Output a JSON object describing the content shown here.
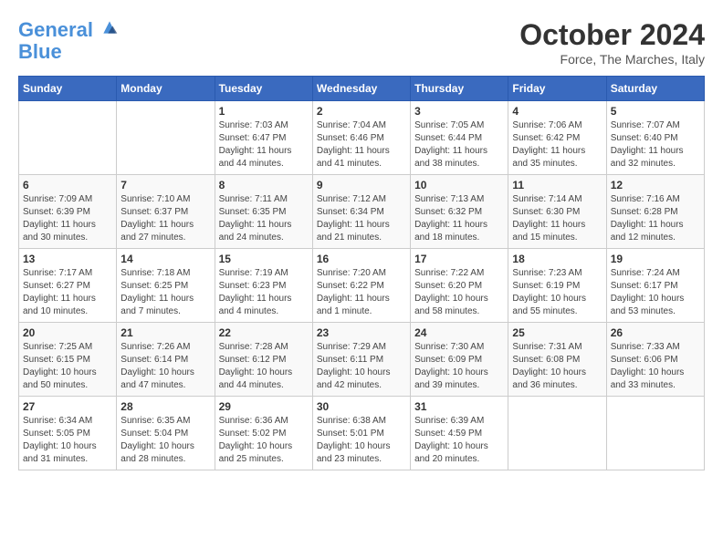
{
  "header": {
    "logo_line1": "General",
    "logo_line2": "Blue",
    "month": "October 2024",
    "location": "Force, The Marches, Italy"
  },
  "days_of_week": [
    "Sunday",
    "Monday",
    "Tuesday",
    "Wednesday",
    "Thursday",
    "Friday",
    "Saturday"
  ],
  "weeks": [
    [
      {
        "day": "",
        "info": ""
      },
      {
        "day": "",
        "info": ""
      },
      {
        "day": "1",
        "info": "Sunrise: 7:03 AM\nSunset: 6:47 PM\nDaylight: 11 hours and 44 minutes."
      },
      {
        "day": "2",
        "info": "Sunrise: 7:04 AM\nSunset: 6:46 PM\nDaylight: 11 hours and 41 minutes."
      },
      {
        "day": "3",
        "info": "Sunrise: 7:05 AM\nSunset: 6:44 PM\nDaylight: 11 hours and 38 minutes."
      },
      {
        "day": "4",
        "info": "Sunrise: 7:06 AM\nSunset: 6:42 PM\nDaylight: 11 hours and 35 minutes."
      },
      {
        "day": "5",
        "info": "Sunrise: 7:07 AM\nSunset: 6:40 PM\nDaylight: 11 hours and 32 minutes."
      }
    ],
    [
      {
        "day": "6",
        "info": "Sunrise: 7:09 AM\nSunset: 6:39 PM\nDaylight: 11 hours and 30 minutes."
      },
      {
        "day": "7",
        "info": "Sunrise: 7:10 AM\nSunset: 6:37 PM\nDaylight: 11 hours and 27 minutes."
      },
      {
        "day": "8",
        "info": "Sunrise: 7:11 AM\nSunset: 6:35 PM\nDaylight: 11 hours and 24 minutes."
      },
      {
        "day": "9",
        "info": "Sunrise: 7:12 AM\nSunset: 6:34 PM\nDaylight: 11 hours and 21 minutes."
      },
      {
        "day": "10",
        "info": "Sunrise: 7:13 AM\nSunset: 6:32 PM\nDaylight: 11 hours and 18 minutes."
      },
      {
        "day": "11",
        "info": "Sunrise: 7:14 AM\nSunset: 6:30 PM\nDaylight: 11 hours and 15 minutes."
      },
      {
        "day": "12",
        "info": "Sunrise: 7:16 AM\nSunset: 6:28 PM\nDaylight: 11 hours and 12 minutes."
      }
    ],
    [
      {
        "day": "13",
        "info": "Sunrise: 7:17 AM\nSunset: 6:27 PM\nDaylight: 11 hours and 10 minutes."
      },
      {
        "day": "14",
        "info": "Sunrise: 7:18 AM\nSunset: 6:25 PM\nDaylight: 11 hours and 7 minutes."
      },
      {
        "day": "15",
        "info": "Sunrise: 7:19 AM\nSunset: 6:23 PM\nDaylight: 11 hours and 4 minutes."
      },
      {
        "day": "16",
        "info": "Sunrise: 7:20 AM\nSunset: 6:22 PM\nDaylight: 11 hours and 1 minute."
      },
      {
        "day": "17",
        "info": "Sunrise: 7:22 AM\nSunset: 6:20 PM\nDaylight: 10 hours and 58 minutes."
      },
      {
        "day": "18",
        "info": "Sunrise: 7:23 AM\nSunset: 6:19 PM\nDaylight: 10 hours and 55 minutes."
      },
      {
        "day": "19",
        "info": "Sunrise: 7:24 AM\nSunset: 6:17 PM\nDaylight: 10 hours and 53 minutes."
      }
    ],
    [
      {
        "day": "20",
        "info": "Sunrise: 7:25 AM\nSunset: 6:15 PM\nDaylight: 10 hours and 50 minutes."
      },
      {
        "day": "21",
        "info": "Sunrise: 7:26 AM\nSunset: 6:14 PM\nDaylight: 10 hours and 47 minutes."
      },
      {
        "day": "22",
        "info": "Sunrise: 7:28 AM\nSunset: 6:12 PM\nDaylight: 10 hours and 44 minutes."
      },
      {
        "day": "23",
        "info": "Sunrise: 7:29 AM\nSunset: 6:11 PM\nDaylight: 10 hours and 42 minutes."
      },
      {
        "day": "24",
        "info": "Sunrise: 7:30 AM\nSunset: 6:09 PM\nDaylight: 10 hours and 39 minutes."
      },
      {
        "day": "25",
        "info": "Sunrise: 7:31 AM\nSunset: 6:08 PM\nDaylight: 10 hours and 36 minutes."
      },
      {
        "day": "26",
        "info": "Sunrise: 7:33 AM\nSunset: 6:06 PM\nDaylight: 10 hours and 33 minutes."
      }
    ],
    [
      {
        "day": "27",
        "info": "Sunrise: 6:34 AM\nSunset: 5:05 PM\nDaylight: 10 hours and 31 minutes."
      },
      {
        "day": "28",
        "info": "Sunrise: 6:35 AM\nSunset: 5:04 PM\nDaylight: 10 hours and 28 minutes."
      },
      {
        "day": "29",
        "info": "Sunrise: 6:36 AM\nSunset: 5:02 PM\nDaylight: 10 hours and 25 minutes."
      },
      {
        "day": "30",
        "info": "Sunrise: 6:38 AM\nSunset: 5:01 PM\nDaylight: 10 hours and 23 minutes."
      },
      {
        "day": "31",
        "info": "Sunrise: 6:39 AM\nSunset: 4:59 PM\nDaylight: 10 hours and 20 minutes."
      },
      {
        "day": "",
        "info": ""
      },
      {
        "day": "",
        "info": ""
      }
    ]
  ]
}
